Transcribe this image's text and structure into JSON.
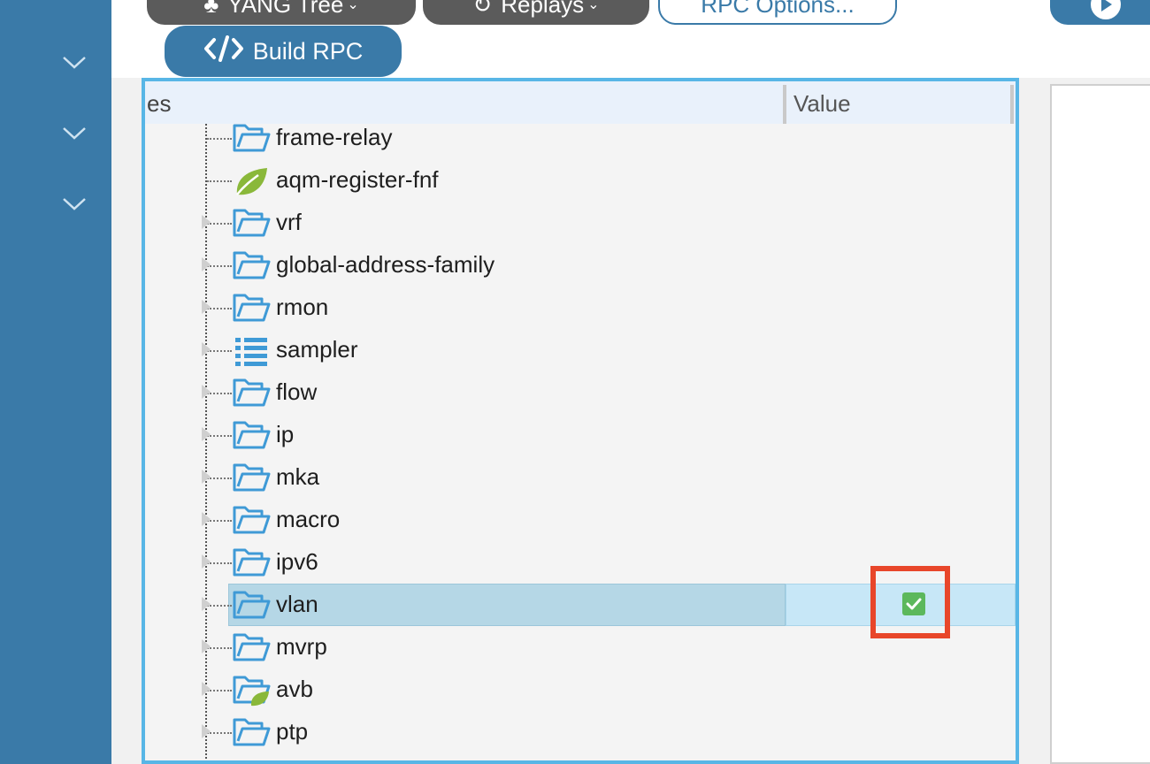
{
  "toolbar": {
    "yang_tree_label": "YANG Tree",
    "replays_label": "Replays",
    "rpc_options_label": "RPC Options...",
    "build_rpc_label": "Build RPC"
  },
  "tree": {
    "header": {
      "names_col": "es",
      "value_col": "Value"
    },
    "rows": [
      {
        "label": "frame-relay",
        "icon": "folder-icon"
      },
      {
        "label": "aqm-register-fnf",
        "icon": "leaf-icon"
      },
      {
        "label": "vrf",
        "icon": "folder-icon"
      },
      {
        "label": "global-address-family",
        "icon": "folder-icon"
      },
      {
        "label": "rmon",
        "icon": "folder-icon"
      },
      {
        "label": "sampler",
        "icon": "list-icon"
      },
      {
        "label": "flow",
        "icon": "folder-icon"
      },
      {
        "label": "ip",
        "icon": "folder-icon"
      },
      {
        "label": "mka",
        "icon": "folder-icon"
      },
      {
        "label": "macro",
        "icon": "folder-icon"
      },
      {
        "label": "ipv6",
        "icon": "folder-icon"
      },
      {
        "label": "vlan",
        "icon": "folder-icon",
        "selected": true,
        "checked": true
      },
      {
        "label": "mvrp",
        "icon": "folder-icon"
      },
      {
        "label": "avb",
        "icon": "folder-leaf-icon"
      },
      {
        "label": "ptp",
        "icon": "folder-icon"
      }
    ]
  },
  "colors": {
    "sidebar": "#3a7aa8",
    "panel_border": "#58b6e6",
    "folder": "#3f9ad6",
    "leaf": "#8ab83a",
    "check": "#5cb85c",
    "highlight": "#e8462a"
  }
}
